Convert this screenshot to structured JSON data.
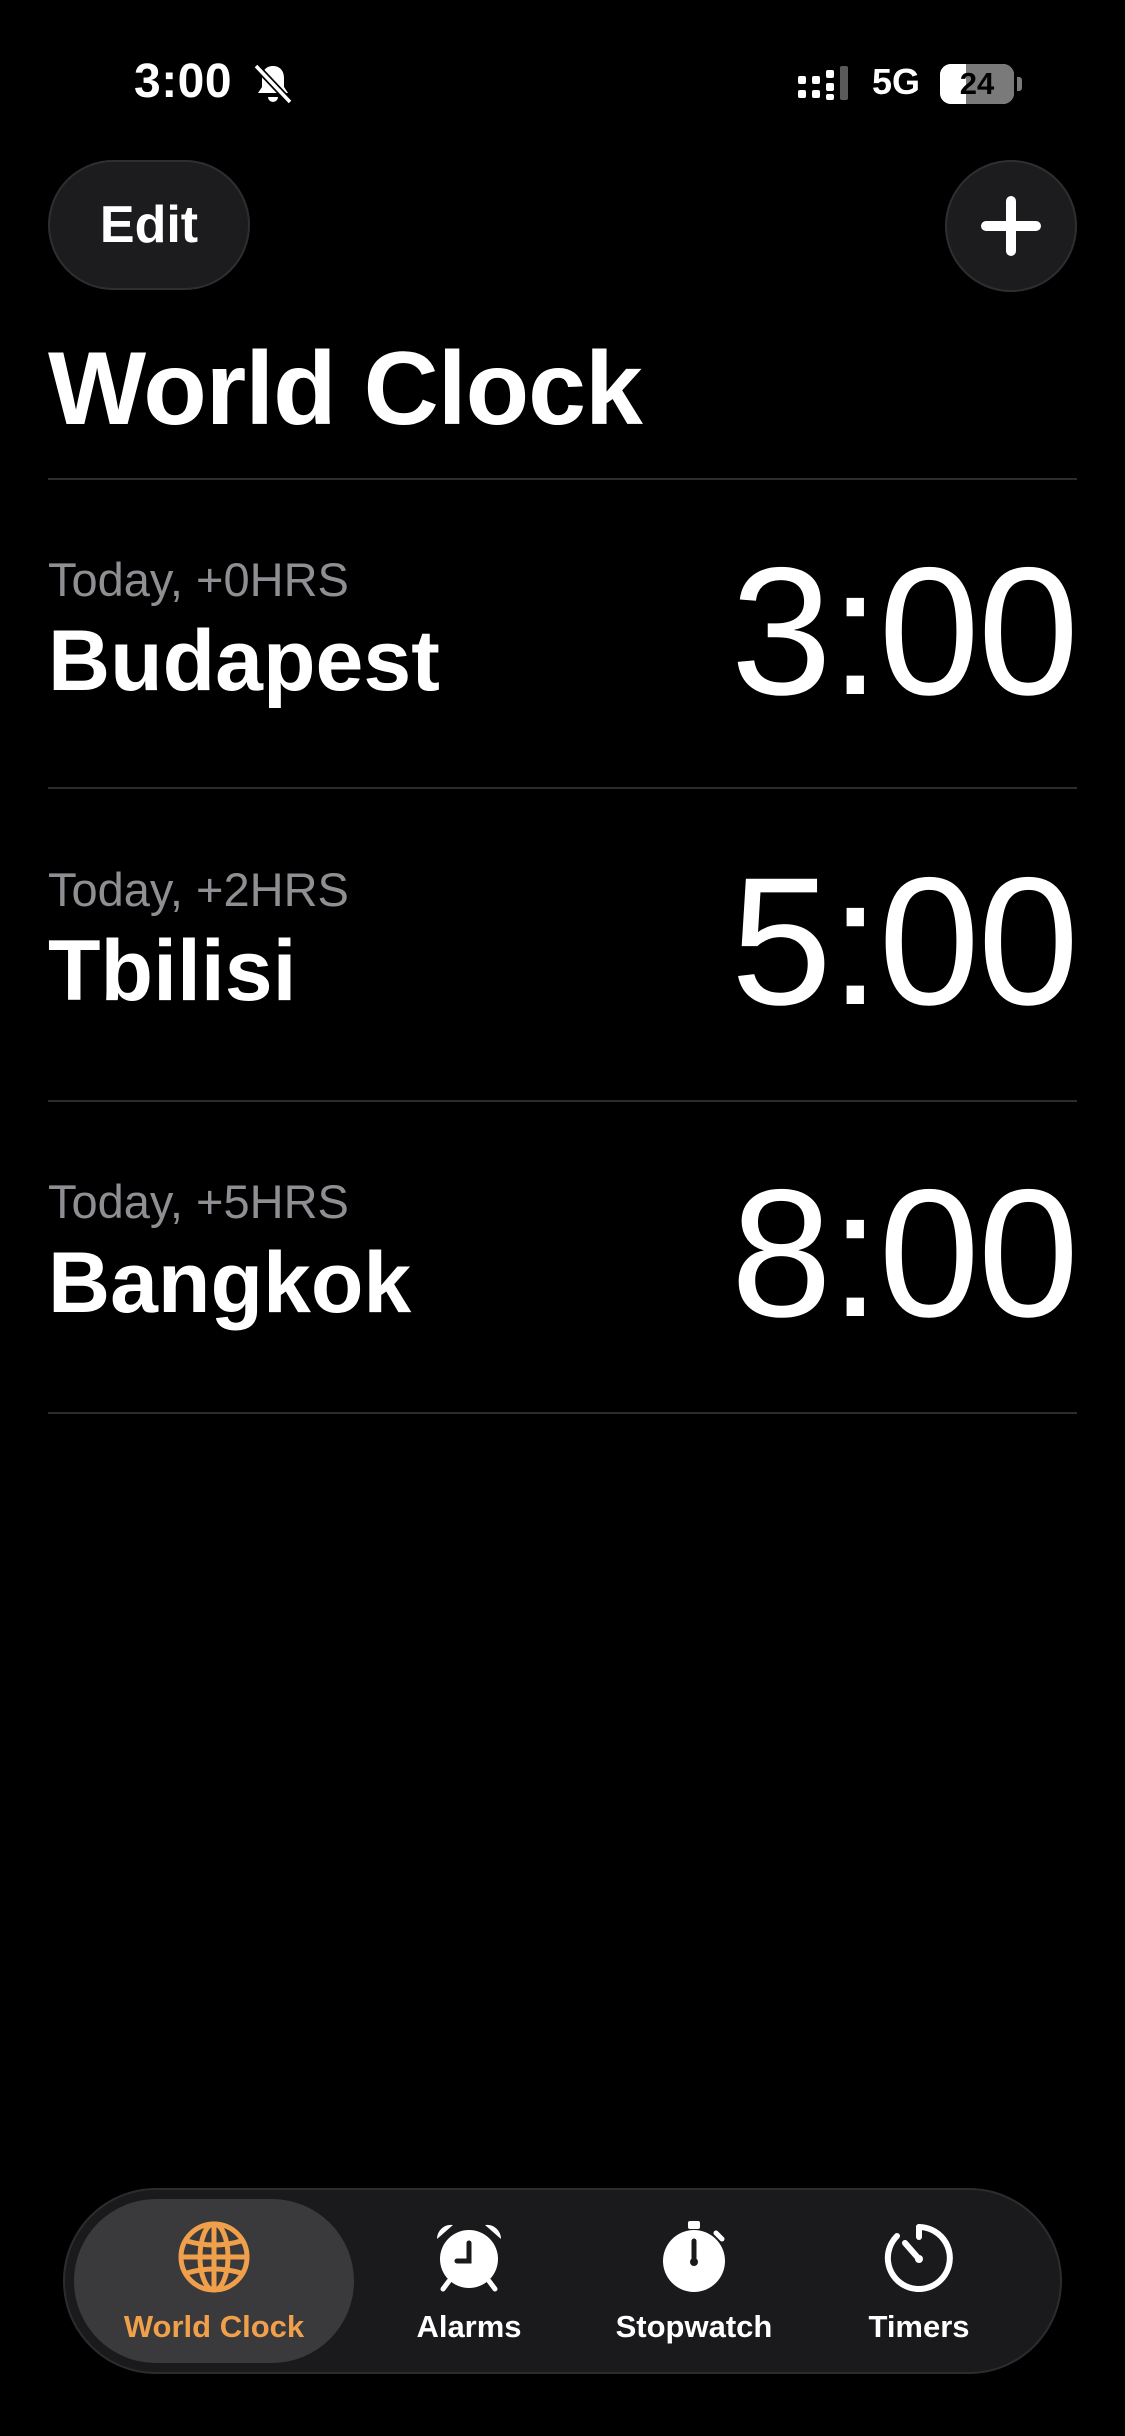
{
  "status_bar": {
    "time": "3:00",
    "network": "5G",
    "battery_level": "24",
    "battery_fraction": 0.24
  },
  "header": {
    "edit_label": "Edit",
    "add_icon": "plus-icon",
    "title": "World Clock"
  },
  "clocks": [
    {
      "offset": "Today, +0HRS",
      "city": "Budapest",
      "time": "3:00"
    },
    {
      "offset": "Today, +2HRS",
      "city": "Tbilisi",
      "time": "5:00"
    },
    {
      "offset": "Today, +5HRS",
      "city": "Bangkok",
      "time": "8:00"
    }
  ],
  "tabs": [
    {
      "label": "World Clock",
      "icon": "globe-icon",
      "active": true
    },
    {
      "label": "Alarms",
      "icon": "alarm-clock-icon",
      "active": false
    },
    {
      "label": "Stopwatch",
      "icon": "stopwatch-icon",
      "active": false
    },
    {
      "label": "Timers",
      "icon": "timer-icon",
      "active": false
    }
  ],
  "colors": {
    "accent": "#f0a04b",
    "background": "#000000",
    "secondary_text": "#8e8e93"
  }
}
